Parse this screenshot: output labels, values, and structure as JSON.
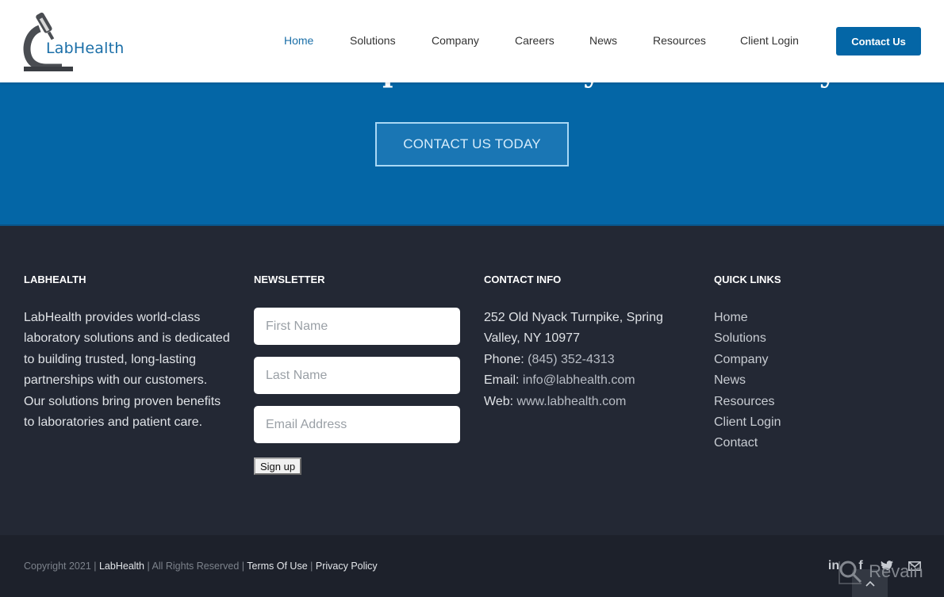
{
  "header": {
    "logo_text": "LabHealth",
    "nav": [
      {
        "label": "Home",
        "active": true
      },
      {
        "label": "Solutions"
      },
      {
        "label": "Company"
      },
      {
        "label": "Careers"
      },
      {
        "label": "News"
      },
      {
        "label": "Resources"
      },
      {
        "label": "Client Login"
      }
    ],
    "cta_label": "Contact Us"
  },
  "hero": {
    "title": "Harness the full potential of your laboratory",
    "cta_label": "CONTACT US TODAY"
  },
  "footer": {
    "about": {
      "title": "LABHEALTH",
      "text": "LabHealth provides world-class laboratory solutions and is dedicated to building trusted, long-lasting partnerships with our customers. Our solutions bring proven benefits to laboratories and patient care."
    },
    "newsletter": {
      "title": "NEWSLETTER",
      "first_name_placeholder": "First Name",
      "last_name_placeholder": "Last Name",
      "email_placeholder": "Email Address",
      "signup_label": "Sign up"
    },
    "contact": {
      "title": "CONTACT INFO",
      "address_line1": "252 Old Nyack Turnpike, Spring",
      "address_line2": "Valley, NY 10977",
      "phone_label": "Phone:",
      "phone": "(845) 352-4313",
      "email_label": "Email:",
      "email": "info@labhealth.com",
      "web_label": "Web:",
      "web": "www.labhealth.com"
    },
    "quick_links": {
      "title": "QUICK LINKS",
      "items": [
        "Home",
        "Solutions",
        "Company",
        "News",
        "Resources",
        "Client Login",
        "Contact"
      ]
    }
  },
  "bottom": {
    "copyright_prefix": "Copyright 2021 |",
    "brand_link": "LabHealth",
    "rights": "| All Rights Reserved |",
    "terms": "Terms Of Use",
    "sep": "|",
    "privacy": "Privacy Policy",
    "social_icons": [
      "linkedin-icon",
      "facebook-icon",
      "twitter-icon",
      "email-icon"
    ],
    "watermark": "Revain"
  },
  "colors": {
    "brand_blue": "#0466a6",
    "footer_bg": "#232834",
    "bottom_bg": "#1d212b"
  }
}
